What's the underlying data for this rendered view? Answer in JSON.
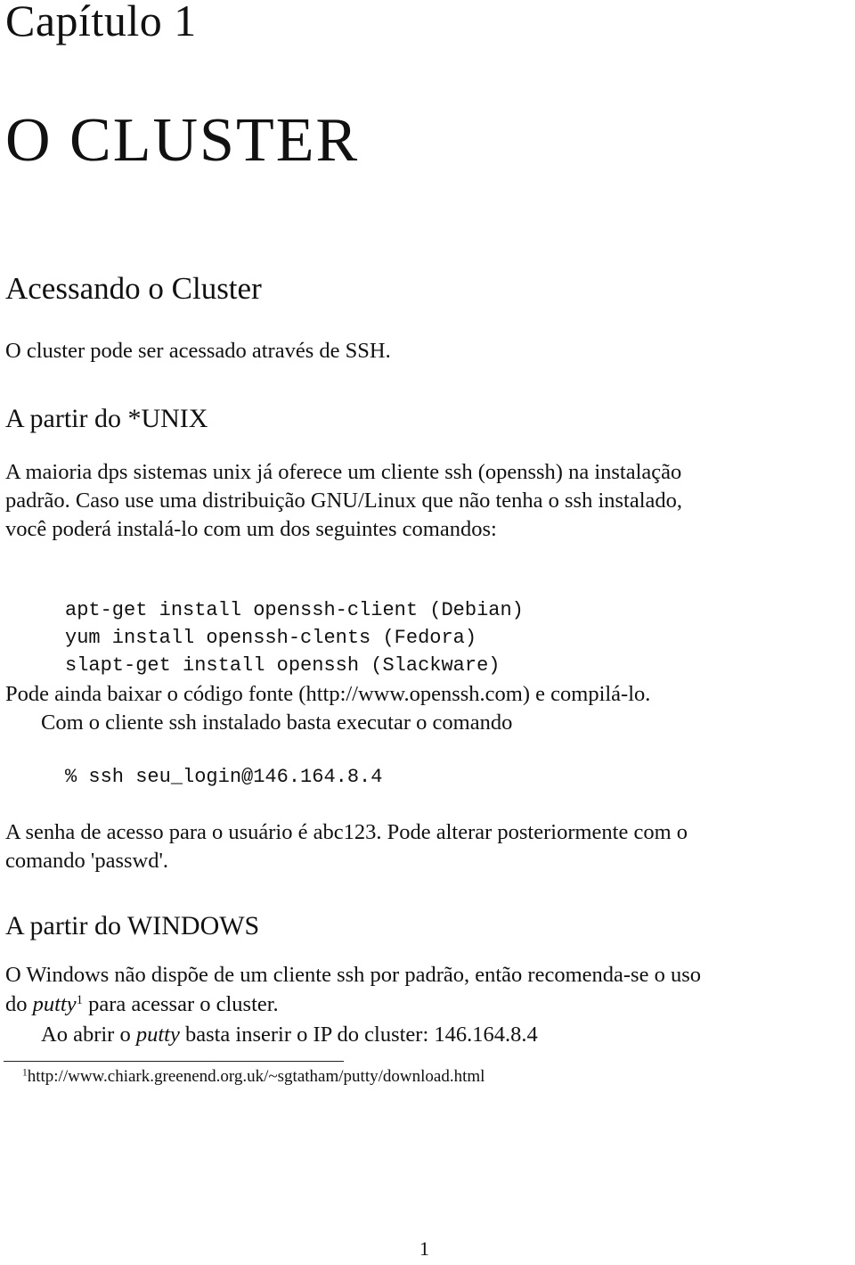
{
  "chapter": {
    "label": "Capítulo 1",
    "title": "O CLUSTER"
  },
  "section": {
    "title": "Acessando o Cluster",
    "intro": "O cluster pode ser acessado através de SSH."
  },
  "unix": {
    "heading": "A partir do *UNIX",
    "para1_line1": "A maioria dps sistemas unix já oferece um cliente ssh (openssh) na instalação",
    "para1_line2": "padrão. Caso use uma distribuição GNU/Linux que não tenha o ssh instalado,",
    "para1_line3": "você poderá instalá-lo com um dos seguintes comandos:",
    "commands": [
      "apt-get install openssh-client (Debian)",
      "yum install openssh-clents (Fedora)",
      "slapt-get install openssh (Slackware)"
    ],
    "source_prefix": "Pode ainda baixar o código fonte (",
    "source_link": "http://www.openssh.com",
    "source_suffix": ") e compilá-lo.",
    "exec_text": "Com o cliente ssh instalado basta executar o comando",
    "ssh_command": "% ssh seu_login@146.164.8.4",
    "password_line1": "A senha de acesso para o usuário é abc123. Pode alterar posteriormente com o",
    "password_line2": "comando 'passwd'."
  },
  "windows": {
    "heading": "A partir do WINDOWS",
    "para_line1": "O Windows não dispõe de um cliente ssh por padrão, então recomenda-se o uso",
    "para_line2_prefix": "do ",
    "para_line2_putty": "putty",
    "para_line2_footnote_mark": "1",
    "para_line2_suffix": " para acessar o cluster.",
    "ip_prefix": "Ao abrir o ",
    "ip_putty": "putty",
    "ip_suffix": " basta inserir o IP do cluster: 146.164.8.4"
  },
  "footnote": {
    "mark": "1",
    "url": "http://www.chiark.greenend.org.uk/~sgtatham/putty/download.html"
  },
  "page_number": "1"
}
